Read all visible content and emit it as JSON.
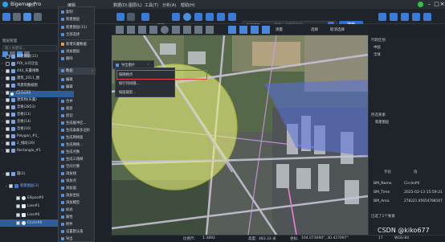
{
  "titlebar": {
    "app_title": "Bigemap Pro",
    "menus": [
      "文件",
      "编辑",
      "数据(D)",
      "图层(L)",
      "工具(T)",
      "分析(A)",
      "帮助(H)"
    ]
  },
  "toolbar": {
    "browse_label": "浏览",
    "search_scope": "全国搜索",
    "search_placeholder": "请输入关键字检索",
    "search_button": "搜索",
    "measure_label": "测量",
    "select_label": "选择",
    "cancel_select_label": "取消选择"
  },
  "layers_panel": {
    "header": "图层管理",
    "search_placeholder": "输入关键词...",
    "tree": [
      {
        "label": "新建图层(11)",
        "checked": false
      },
      {
        "label": "POI_公司企业",
        "checked": false
      },
      {
        "label": "444_矢量线数",
        "checked": true
      },
      {
        "label": "建筑_2011_图",
        "checked": true
      },
      {
        "label": "带建筑数据图",
        "checked": true
      },
      {
        "label": "新建图层(4)",
        "checked": true
      },
      {
        "label": "建筑物(矢量)",
        "checked": true
      },
      {
        "label": "音格(2853)",
        "checked": true
      },
      {
        "label": "音格(11)",
        "checked": true
      },
      {
        "label": "音格(14)",
        "checked": true
      },
      {
        "label": "音格(16)",
        "checked": true
      },
      {
        "label": "Polygon_#1_",
        "checked": true
      },
      {
        "label": "2_线段(20)",
        "checked": true
      },
      {
        "label": "Rectangle_#1",
        "checked": true
      },
      {
        "label": "圆(1)",
        "checked": true
      },
      {
        "label": "新建图层(3)",
        "checked": true
      },
      {
        "label": "Ellipse#0",
        "checked": true
      },
      {
        "label": "Line#1",
        "checked": true
      },
      {
        "label": "Line#0",
        "checked": true
      },
      {
        "label": "Circle#0",
        "checked": true
      }
    ]
  },
  "context_menu": {
    "items": [
      "复制",
      "粘贴",
      "全部选择",
      "取消选择",
      "新增矢量数据",
      "添加图层",
      "删除",
      "数据",
      "编辑",
      "编辑",
      "裁剪",
      "合并",
      "裁剪",
      "扩展多边形...",
      "生成缓冲区...",
      "生成泰森多边形",
      "生成网格面",
      "生成网格...",
      "生成点数",
      "生成三角网",
      "空间计算",
      "添加线...",
      "添加点...",
      "添加面...",
      "添加坐标(从折图导出)",
      "添加模型(从折图导出)",
      "样式...",
      "属性...",
      "附件...",
      "设置默认值",
      "导出",
      "图层管理",
      "图层列表",
      "添加到收藏夹",
      "高级",
      "删除",
      "重命名",
      "剪切到图层...",
      "刷新"
    ],
    "right_column": [
      "复制",
      "新建图层",
      "新建图层(11)",
      "全部选择",
      "新增矢量数据",
      "添加图层",
      "删除",
      "数据",
      "编辑",
      "编辑",
      "裁剪",
      "合并",
      "裁剪",
      "剪切",
      "生成缓冲区...",
      "生成泰森多边形",
      "生成网格面",
      "生成网格...",
      "生成点数",
      "生成三角网",
      "空间计算",
      "添加线",
      "添加点",
      "添加面",
      "添加坐标",
      "添加模型",
      "样式",
      "属性",
      "附件",
      "设置默认值",
      "导出",
      "图层管理",
      "图层列表",
      "收藏夹",
      "高级",
      "删除",
      "重命名",
      "刷新"
    ],
    "highlighted": "导出",
    "export_submenu_title": "导出图片",
    "submenu_items": [
      "按网格点",
      "按行列间隔...",
      "按面裁剪..."
    ]
  },
  "right_panel": {
    "admin_title": "行政区划",
    "admin_items": [
      "中国",
      "全球"
    ],
    "features_title": "所选要素",
    "layer_node": "新建图层",
    "selected_feature": "Circle#0",
    "attr_header": [
      "字段",
      "值"
    ],
    "attrs": [
      {
        "field": "BM_Name",
        "value": "Circle#0"
      },
      {
        "field": "BM_Time",
        "value": "2025-02-13 15:59:21"
      },
      {
        "field": "BM_Area",
        "value": "278221.95654798107"
      }
    ],
    "footer": "已选了1个要素"
  },
  "statusbar": {
    "scale_label": "比例尺:",
    "scale_value": "1:3892",
    "height_label": "高度:",
    "height_value": "483.33 米",
    "coord_label": "坐标:",
    "coord_value": "104.073690°, 30.427097°",
    "zoom_label": "17",
    "projection_label": "WGS-84"
  },
  "watermark": "CSDN @kiko677",
  "colors": {
    "circle_fill": "#e7f07a",
    "circle_stroke": "#d6e43a",
    "polygon_fill": "#5a6fe0",
    "highlight": "#e8404b",
    "selection": "#2c5d99",
    "accent": "#2d6fd6"
  }
}
